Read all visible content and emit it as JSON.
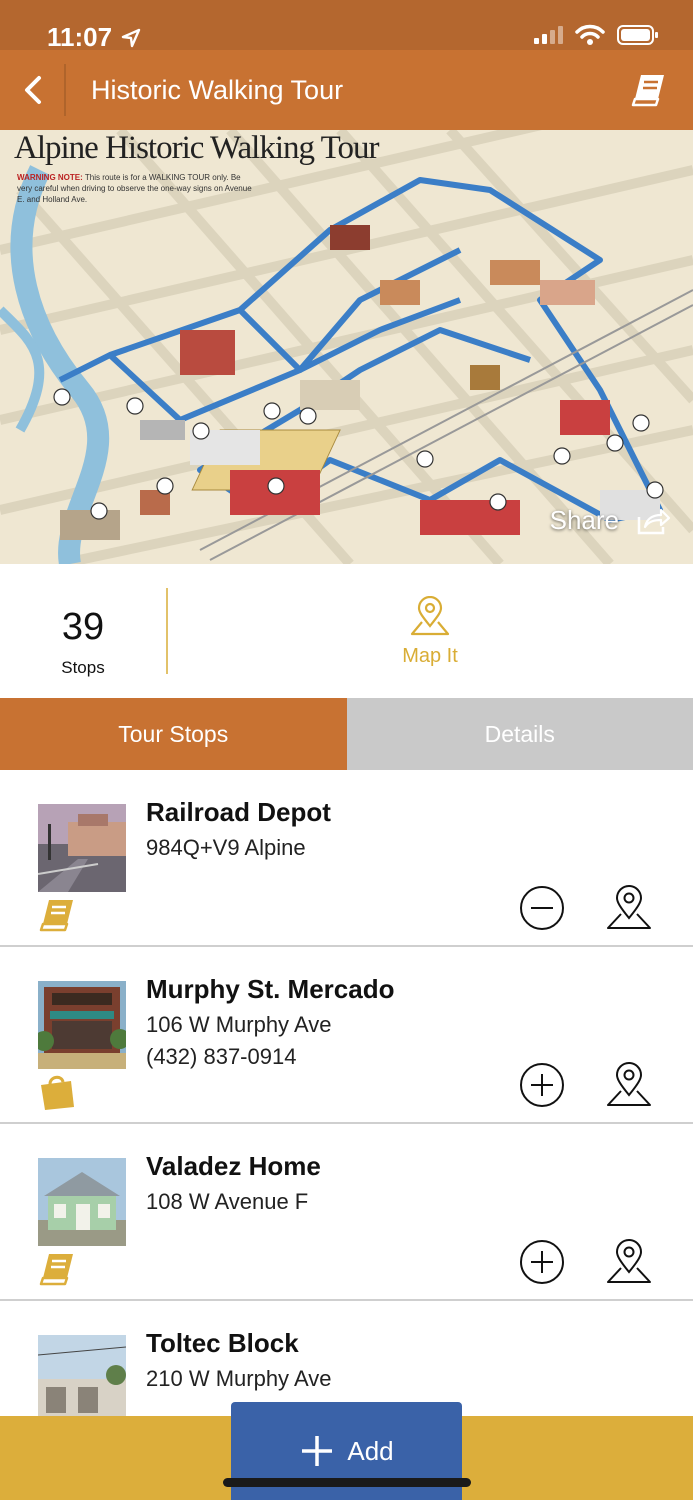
{
  "status": {
    "time": "11:07"
  },
  "nav": {
    "title": "Historic Walking Tour"
  },
  "map": {
    "title": "Alpine Historic Walking Tour",
    "warning_label": "WARNING NOTE:",
    "warning_text": " This route is for a WALKING TOUR only. Be very careful when driving to observe the one-way signs on Avenue E. and Holland Ave.",
    "share_label": "Share"
  },
  "stats": {
    "count": "39",
    "count_label": "Stops",
    "map_it_label": "Map It"
  },
  "tabs": [
    {
      "label": "Tour Stops"
    },
    {
      "label": "Details"
    }
  ],
  "stops": [
    {
      "title": "Railroad Depot",
      "line1": "984Q+V9 Alpine",
      "line2": "",
      "category_icon": "book-icon",
      "action": "remove"
    },
    {
      "title": "Murphy St. Mercado",
      "line1": "106 W Murphy Ave",
      "line2": "(432) 837-0914",
      "category_icon": "shopping-bag-icon",
      "action": "add"
    },
    {
      "title": "Valadez Home",
      "line1": "108 W Avenue F",
      "line2": "",
      "category_icon": "book-icon",
      "action": "add"
    },
    {
      "title": "Toltec Block",
      "line1": "210 W Murphy Ave",
      "line2": "",
      "category_icon": "book-icon",
      "action": "add"
    }
  ],
  "add_button": {
    "label": "Add"
  },
  "colors": {
    "brand": "#c87232",
    "accent": "#dcae3b",
    "add": "#3a62a8"
  }
}
